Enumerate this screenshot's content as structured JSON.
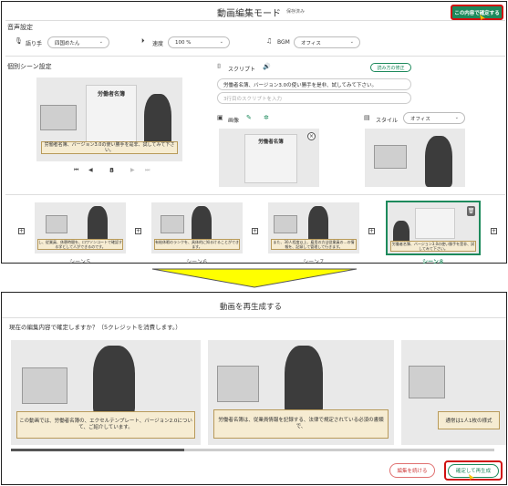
{
  "top": {
    "title": "動画編集モード",
    "saved": "保存済み",
    "confirm_button": "この内容で確定する",
    "audio_section": "音声設定",
    "narrator_label": "語り手",
    "narrator_value": "四国めたん",
    "speed_label": "速度",
    "speed_value": "100 %",
    "bgm_label": "BGM",
    "bgm_value": "オフィス",
    "scene_section": "個別シーン設定",
    "preview_doc_title": "労働者名簿",
    "preview_caption": "労働者名簿、バージョン3.0の使い勝手を是非、試してみて下さい。",
    "scene_number": "8",
    "script_label": "スクリプト",
    "read_aloud_button": "読み方の修正",
    "script_text": "労働者名簿、バージョン3.0の使い勝手を是非、試してみて下さい。",
    "script_placeholder": "3行目のスクリプトを入力",
    "image_label": "画像",
    "style_label": "スタイル",
    "style_value": "オフィス",
    "scenes": [
      {
        "label": "シーン５",
        "caption": "し、従業員、休憩時間を、ロワソンコートで確認する学として人ができるのです。"
      },
      {
        "label": "シーン６",
        "caption": "有給休暇のランクを、具体的に知るけることができます。"
      },
      {
        "label": "シーン７",
        "caption": "また、30人程度以上、雇用の方は従業員の…の情報を、記録して管理して行きます。"
      },
      {
        "label": "シーン８",
        "caption": "労働者名簿、バージョン3.0の使い勝手を是非、試してみて下さい。"
      }
    ]
  },
  "bottom": {
    "title": "動画を再生成する",
    "question": "現在の編集内容で確定しますか？（5クレジットを消費します。）",
    "cards": [
      {
        "caption": "この動画では、労働者名簿の、エクセルテンプレート、バージョン2.0について、ご紹介しています。"
      },
      {
        "caption": "労働者名簿は、従業員情報を記録する、法律で規定されている必須の書類で、"
      },
      {
        "caption": "通常は1人1枚の様式"
      }
    ],
    "continue_button": "編集を続ける",
    "regenerate_button": "確定して再生成"
  },
  "colors": {
    "accent": "#1d8a5c",
    "highlight": "#d01010",
    "arrow": "#ffff00"
  }
}
